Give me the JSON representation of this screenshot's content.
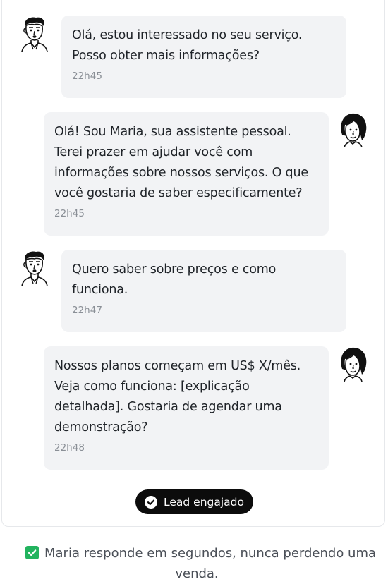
{
  "messages": [
    {
      "sender": "lead",
      "text": "Olá, estou interessado no seu serviço.\nPosso obter mais informações?",
      "time": "22h45"
    },
    {
      "sender": "assistant",
      "text": "Olá! Sou Maria, sua assistente pessoal.\nTerei prazer em ajudar você com\ninformações sobre nossos serviços. O que\nvocê gostaria de saber especificamente?",
      "time": "22h45"
    },
    {
      "sender": "lead",
      "text": "Quero saber sobre preços e como\nfunciona.",
      "time": "22h47"
    },
    {
      "sender": "assistant",
      "text": "Nossos planos começam em US$ X/mês.\nVeja como funciona: [explicação\ndetalhada]. Gostaria de agendar uma\ndemonstração?",
      "time": "22h48"
    }
  ],
  "status_badge": {
    "label": "Lead engajado",
    "icon": "check-circle-icon",
    "background": "#0c0c0c"
  },
  "footer": {
    "line1": "Maria responde em segundos, nunca perdendo uma",
    "line2": "venda.",
    "icon": "checkbox-checked-icon",
    "accent": "#22b35e"
  },
  "colors": {
    "bubble": "#f2f3f5",
    "text": "#1f2328",
    "time": "#8a8f96"
  }
}
